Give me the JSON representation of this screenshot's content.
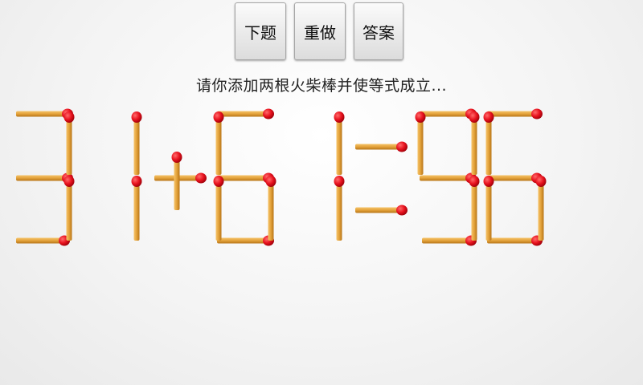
{
  "toolbar": {
    "next_label": "下题",
    "redo_label": "重做",
    "answer_label": "答案"
  },
  "instruction": "请你添加两根火柴棒并使等式成立...",
  "equation": {
    "characters": [
      "3",
      "1",
      "+",
      "6",
      "1",
      "=",
      "9",
      "6"
    ],
    "text": "31+61=96"
  },
  "colors": {
    "stick": "#e3a23a",
    "stick_dark": "#b87518",
    "match_head": "#e8121e"
  }
}
